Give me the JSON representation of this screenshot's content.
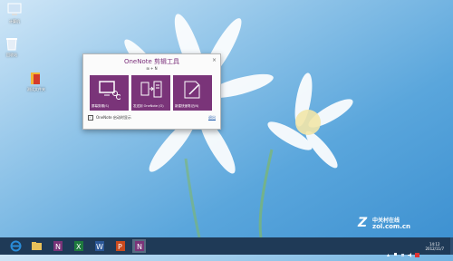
{
  "desktop": {
    "icons": [
      {
        "label": "计算机",
        "icon": "computer-icon"
      },
      {
        "label": "回收站",
        "icon": "recycle-bin-icon"
      },
      {
        "label": "测试文件夹",
        "icon": "folder-icon"
      }
    ]
  },
  "dialog": {
    "title": "OneNote 剪辑工具",
    "subtitle": "⊞ + N",
    "close": "×",
    "tiles": [
      {
        "label": "屏幕剪辑(S)",
        "icon": "screen-clip-icon"
      },
      {
        "label": "发送到 OneNote (O)",
        "icon": "send-to-onenote-icon"
      },
      {
        "label": "新建快速笔记(N)",
        "icon": "quick-note-icon"
      }
    ],
    "checkbox_label": "OneNote 启动时显示",
    "checkbox_checked": true,
    "exit_label": "退出"
  },
  "watermark": {
    "logo": "Z",
    "cn": "中关村在线",
    "domain": "zol.com.cn"
  },
  "taskbar": {
    "apps": [
      {
        "name": "internet-explorer",
        "color": "#2a8cd8"
      },
      {
        "name": "file-explorer",
        "color": "#e9c15a"
      },
      {
        "name": "onenote",
        "color": "#7a3479"
      },
      {
        "name": "excel",
        "color": "#1e7a3e"
      },
      {
        "name": "word",
        "color": "#2b5797"
      },
      {
        "name": "powerpoint",
        "color": "#c94a1e"
      },
      {
        "name": "onenote-clipping",
        "color": "#7a3479"
      }
    ],
    "clock_time": "14:12",
    "clock_date": "2012/11/7"
  }
}
